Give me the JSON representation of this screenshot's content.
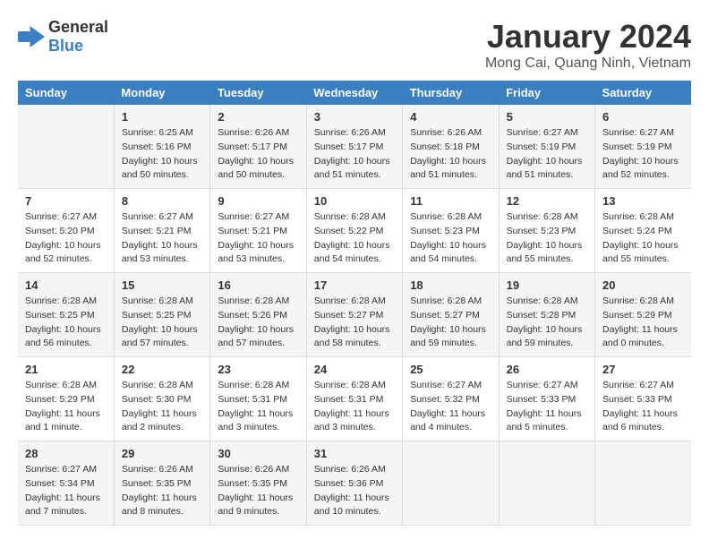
{
  "header": {
    "logo_general": "General",
    "logo_blue": "Blue",
    "month": "January 2024",
    "location": "Mong Cai, Quang Ninh, Vietnam"
  },
  "columns": [
    "Sunday",
    "Monday",
    "Tuesday",
    "Wednesday",
    "Thursday",
    "Friday",
    "Saturday"
  ],
  "weeks": [
    [
      {
        "day": "",
        "info": ""
      },
      {
        "day": "1",
        "info": "Sunrise: 6:25 AM\nSunset: 5:16 PM\nDaylight: 10 hours\nand 50 minutes."
      },
      {
        "day": "2",
        "info": "Sunrise: 6:26 AM\nSunset: 5:17 PM\nDaylight: 10 hours\nand 50 minutes."
      },
      {
        "day": "3",
        "info": "Sunrise: 6:26 AM\nSunset: 5:17 PM\nDaylight: 10 hours\nand 51 minutes."
      },
      {
        "day": "4",
        "info": "Sunrise: 6:26 AM\nSunset: 5:18 PM\nDaylight: 10 hours\nand 51 minutes."
      },
      {
        "day": "5",
        "info": "Sunrise: 6:27 AM\nSunset: 5:19 PM\nDaylight: 10 hours\nand 51 minutes."
      },
      {
        "day": "6",
        "info": "Sunrise: 6:27 AM\nSunset: 5:19 PM\nDaylight: 10 hours\nand 52 minutes."
      }
    ],
    [
      {
        "day": "7",
        "info": "Sunrise: 6:27 AM\nSunset: 5:20 PM\nDaylight: 10 hours\nand 52 minutes."
      },
      {
        "day": "8",
        "info": "Sunrise: 6:27 AM\nSunset: 5:21 PM\nDaylight: 10 hours\nand 53 minutes."
      },
      {
        "day": "9",
        "info": "Sunrise: 6:27 AM\nSunset: 5:21 PM\nDaylight: 10 hours\nand 53 minutes."
      },
      {
        "day": "10",
        "info": "Sunrise: 6:28 AM\nSunset: 5:22 PM\nDaylight: 10 hours\nand 54 minutes."
      },
      {
        "day": "11",
        "info": "Sunrise: 6:28 AM\nSunset: 5:23 PM\nDaylight: 10 hours\nand 54 minutes."
      },
      {
        "day": "12",
        "info": "Sunrise: 6:28 AM\nSunset: 5:23 PM\nDaylight: 10 hours\nand 55 minutes."
      },
      {
        "day": "13",
        "info": "Sunrise: 6:28 AM\nSunset: 5:24 PM\nDaylight: 10 hours\nand 55 minutes."
      }
    ],
    [
      {
        "day": "14",
        "info": "Sunrise: 6:28 AM\nSunset: 5:25 PM\nDaylight: 10 hours\nand 56 minutes."
      },
      {
        "day": "15",
        "info": "Sunrise: 6:28 AM\nSunset: 5:25 PM\nDaylight: 10 hours\nand 57 minutes."
      },
      {
        "day": "16",
        "info": "Sunrise: 6:28 AM\nSunset: 5:26 PM\nDaylight: 10 hours\nand 57 minutes."
      },
      {
        "day": "17",
        "info": "Sunrise: 6:28 AM\nSunset: 5:27 PM\nDaylight: 10 hours\nand 58 minutes."
      },
      {
        "day": "18",
        "info": "Sunrise: 6:28 AM\nSunset: 5:27 PM\nDaylight: 10 hours\nand 59 minutes."
      },
      {
        "day": "19",
        "info": "Sunrise: 6:28 AM\nSunset: 5:28 PM\nDaylight: 10 hours\nand 59 minutes."
      },
      {
        "day": "20",
        "info": "Sunrise: 6:28 AM\nSunset: 5:29 PM\nDaylight: 11 hours\nand 0 minutes."
      }
    ],
    [
      {
        "day": "21",
        "info": "Sunrise: 6:28 AM\nSunset: 5:29 PM\nDaylight: 11 hours\nand 1 minute."
      },
      {
        "day": "22",
        "info": "Sunrise: 6:28 AM\nSunset: 5:30 PM\nDaylight: 11 hours\nand 2 minutes."
      },
      {
        "day": "23",
        "info": "Sunrise: 6:28 AM\nSunset: 5:31 PM\nDaylight: 11 hours\nand 3 minutes."
      },
      {
        "day": "24",
        "info": "Sunrise: 6:28 AM\nSunset: 5:31 PM\nDaylight: 11 hours\nand 3 minutes."
      },
      {
        "day": "25",
        "info": "Sunrise: 6:27 AM\nSunset: 5:32 PM\nDaylight: 11 hours\nand 4 minutes."
      },
      {
        "day": "26",
        "info": "Sunrise: 6:27 AM\nSunset: 5:33 PM\nDaylight: 11 hours\nand 5 minutes."
      },
      {
        "day": "27",
        "info": "Sunrise: 6:27 AM\nSunset: 5:33 PM\nDaylight: 11 hours\nand 6 minutes."
      }
    ],
    [
      {
        "day": "28",
        "info": "Sunrise: 6:27 AM\nSunset: 5:34 PM\nDaylight: 11 hours\nand 7 minutes."
      },
      {
        "day": "29",
        "info": "Sunrise: 6:26 AM\nSunset: 5:35 PM\nDaylight: 11 hours\nand 8 minutes."
      },
      {
        "day": "30",
        "info": "Sunrise: 6:26 AM\nSunset: 5:35 PM\nDaylight: 11 hours\nand 9 minutes."
      },
      {
        "day": "31",
        "info": "Sunrise: 6:26 AM\nSunset: 5:36 PM\nDaylight: 11 hours\nand 10 minutes."
      },
      {
        "day": "",
        "info": ""
      },
      {
        "day": "",
        "info": ""
      },
      {
        "day": "",
        "info": ""
      }
    ]
  ]
}
